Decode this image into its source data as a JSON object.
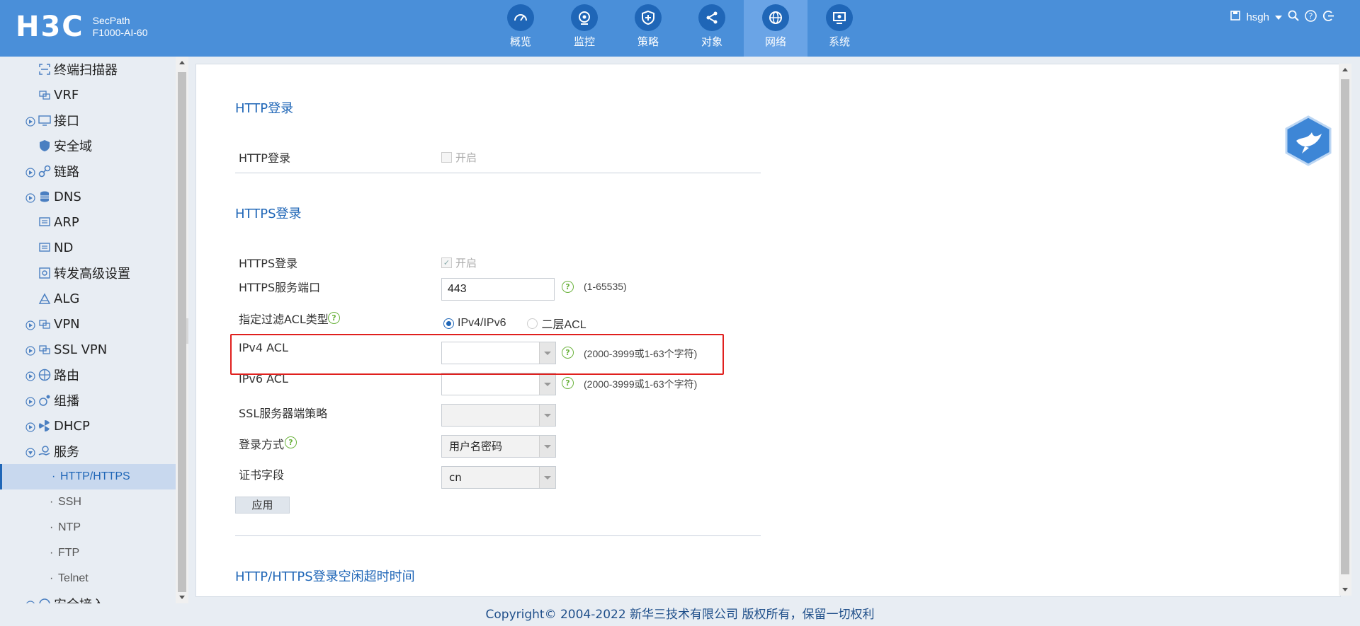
{
  "header": {
    "logo": "H3C",
    "product_line1": "SecPath",
    "product_line2": "F1000-AI-60",
    "nav": [
      {
        "label": "概览",
        "icon": "dashboard-icon"
      },
      {
        "label": "监控",
        "icon": "monitor-icon"
      },
      {
        "label": "策略",
        "icon": "shield-icon"
      },
      {
        "label": "对象",
        "icon": "share-icon"
      },
      {
        "label": "网络",
        "icon": "globe-icon",
        "active": true
      },
      {
        "label": "系统",
        "icon": "system-icon"
      }
    ],
    "username": "hsgh"
  },
  "sidebar": {
    "items": [
      {
        "label": "终端扫描器",
        "icon": "scanner-icon"
      },
      {
        "label": "VRF",
        "icon": "vrf-icon"
      },
      {
        "label": "接口",
        "icon": "interface-icon",
        "expandable": true
      },
      {
        "label": "安全域",
        "icon": "security-zone-icon"
      },
      {
        "label": "链路",
        "icon": "link-icon",
        "expandable": true
      },
      {
        "label": "DNS",
        "icon": "database-icon",
        "expandable": true
      },
      {
        "label": "ARP",
        "icon": "arp-icon"
      },
      {
        "label": "ND",
        "icon": "nd-icon"
      },
      {
        "label": "转发高级设置",
        "icon": "forward-settings-icon"
      },
      {
        "label": "ALG",
        "icon": "alg-icon"
      },
      {
        "label": "VPN",
        "icon": "vpn-icon",
        "expandable": true
      },
      {
        "label": "SSL VPN",
        "icon": "ssl-vpn-icon",
        "expandable": true
      },
      {
        "label": "路由",
        "icon": "route-icon",
        "expandable": true
      },
      {
        "label": "组播",
        "icon": "multicast-icon",
        "expandable": true
      },
      {
        "label": "DHCP",
        "icon": "dhcp-icon",
        "expandable": true
      },
      {
        "label": "服务",
        "icon": "service-icon",
        "expandable": true
      }
    ],
    "sub_items": [
      {
        "label": "HTTP/HTTPS",
        "active": true
      },
      {
        "label": "SSH"
      },
      {
        "label": "NTP"
      },
      {
        "label": "FTP"
      },
      {
        "label": "Telnet"
      }
    ],
    "partial_item": "安全接入"
  },
  "main": {
    "http_section": {
      "title": "HTTP登录",
      "field_label": "HTTP登录",
      "checkbox_label": "开启"
    },
    "https_section": {
      "title": "HTTPS登录",
      "login_label": "HTTPS登录",
      "login_checkbox_label": "开启",
      "port_label": "HTTPS服务端口",
      "port_value": "443",
      "port_hint": "(1-65535)",
      "acl_type_label": "指定过滤ACL类型",
      "acl_type_options": [
        "IPv4/IPv6",
        "二层ACL"
      ],
      "ipv4_acl_label": "IPv4 ACL",
      "ipv4_acl_hint": "(2000-3999或1-63个字符)",
      "ipv6_acl_label": "IPv6 ACL",
      "ipv6_acl_hint": "(2000-3999或1-63个字符)",
      "ssl_policy_label": "SSL服务器端策略",
      "login_method_label": "登录方式",
      "login_method_value": "用户名密码",
      "cert_field_label": "证书字段",
      "cert_field_value": "cn",
      "apply_label": "应用"
    },
    "timeout_section": {
      "title": "HTTP/HTTPS登录空闲超时时间"
    }
  },
  "footer": {
    "text": "Copyright© 2004-2022 新华三技术有限公司 版权所有，保留一切权利"
  },
  "colors": {
    "header_bg": "#4a8fd9",
    "accent": "#1f66b7",
    "help_green": "#6cb33e",
    "highlight_red": "#e0201e"
  }
}
